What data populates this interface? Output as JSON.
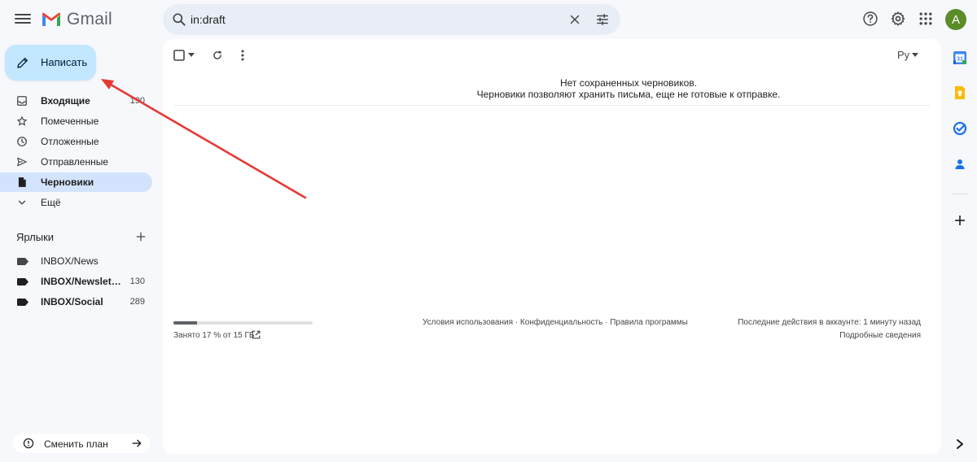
{
  "header": {
    "app_name": "Gmail",
    "search_value": "in:draft",
    "avatar_letter": "A"
  },
  "compose": {
    "label": "Написать"
  },
  "nav": {
    "items": [
      {
        "label": "Входящие",
        "count": "190",
        "bold": true
      },
      {
        "label": "Помеченные",
        "count": ""
      },
      {
        "label": "Отложенные",
        "count": ""
      },
      {
        "label": "Отправленные",
        "count": ""
      },
      {
        "label": "Черновики",
        "count": "",
        "active": true,
        "bold": true
      },
      {
        "label": "Ещё",
        "count": ""
      }
    ]
  },
  "labels": {
    "heading": "Ярлыки",
    "items": [
      {
        "label": "INBOX/News",
        "count": ""
      },
      {
        "label": "INBOX/Newsletters",
        "count": "130",
        "bold": true
      },
      {
        "label": "INBOX/Social",
        "count": "289",
        "bold": true
      }
    ]
  },
  "plan": {
    "label": "Сменить план"
  },
  "main": {
    "sort_label": "Ру",
    "empty_title": "Нет сохраненных черновиков.",
    "empty_subtitle": "Черновики позволяют хранить письма, еще не готовые к отправке.",
    "storage_text": "Занято 17 % от 15 ГБ",
    "storage_fraction": 0.17,
    "footer_terms": "Условия использования",
    "footer_privacy": "Конфиденциальность",
    "footer_program": "Правила программы",
    "footer_sep": " · ",
    "activity": "Последние действия в аккаунте: 1 минуту назад",
    "details": "Подробные сведения"
  },
  "colors": {
    "accent": "#c2e7ff",
    "active_nav": "#d3e3fd",
    "annotation_arrow": "#e53935"
  }
}
